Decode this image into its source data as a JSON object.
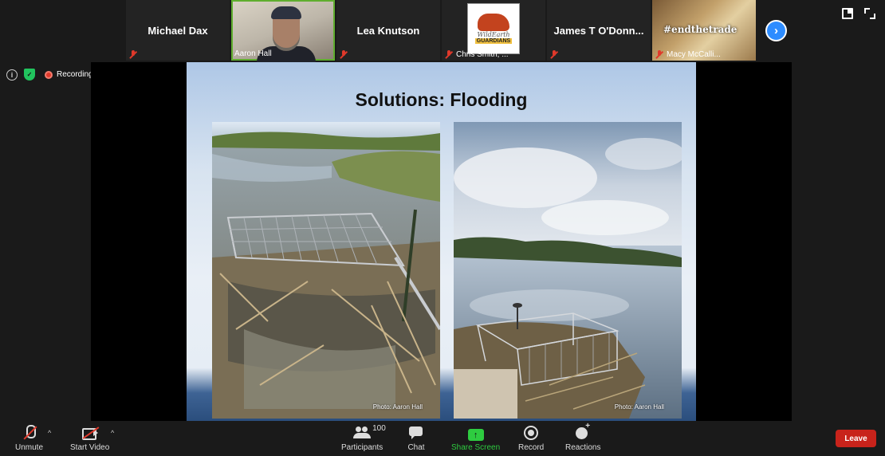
{
  "participants": [
    {
      "name": "Michael Dax",
      "muted": true,
      "display": "name"
    },
    {
      "name": "Aaron Hall",
      "muted": false,
      "display": "video",
      "active_speaker": true
    },
    {
      "name": "Lea Knutson",
      "muted": true,
      "display": "name"
    },
    {
      "name": "Chris Smith, ...",
      "muted": true,
      "display": "logo",
      "logo_text": "WildEarth",
      "logo_sub": "GUARDIANS"
    },
    {
      "name": "James T O'Donn...",
      "muted": true,
      "display": "name"
    },
    {
      "name": "Macy McCalli...",
      "muted": true,
      "display": "image",
      "image_text": "#endthetrade"
    }
  ],
  "status": {
    "info_icon": "info-icon",
    "security_icon": "shield-icon",
    "recording_label": "Recording"
  },
  "shared_slide": {
    "title": "Solutions: Flooding",
    "photos": [
      {
        "credit": "Photo: Aaron Hall"
      },
      {
        "credit": "Photo: Aaron Hall"
      }
    ]
  },
  "toolbar": {
    "unmute_label": "Unmute",
    "start_video_label": "Start Video",
    "participants_label": "Participants",
    "participants_count": "100",
    "chat_label": "Chat",
    "share_screen_label": "Share Screen",
    "record_label": "Record",
    "reactions_label": "Reactions",
    "leave_label": "Leave"
  },
  "colors": {
    "accent_blue": "#2d8cff",
    "share_green": "#2ecc40",
    "leave_red": "#c8231b",
    "speaker_border": "#5fae2e"
  }
}
